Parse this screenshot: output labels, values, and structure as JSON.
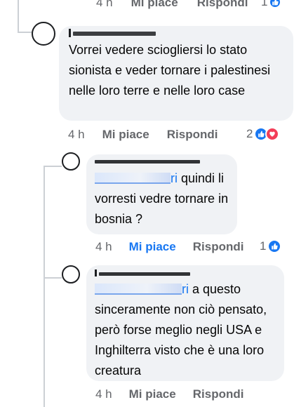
{
  "colors": {
    "link_blue": "#1877f2",
    "meta_grey": "#65676b",
    "bubble_bg": "#f0f2f5"
  },
  "top_row": {
    "time": "4 h",
    "like": "Mi piace",
    "reply": "Rispondi",
    "count": "1"
  },
  "comment1": {
    "text": "Vorrei vedere sciogliersi lo stato sionista e veder tornare i palestinesi nelle loro terre e nelle loro case",
    "time": "4 h",
    "like": "Mi piace",
    "reply": "Rispondi",
    "count": "2",
    "reactions": [
      "like-icon",
      "love-icon"
    ]
  },
  "reply1": {
    "mention_tail": "ri",
    "text": " quindi li vorresti vedre tornare in bosnia ?",
    "time": "4 h",
    "like": "Mi piace",
    "reply": "Rispondi",
    "count": "1",
    "liked": true,
    "reactions": [
      "like-icon"
    ]
  },
  "reply2": {
    "mention_tail": "ri",
    "text": " a questo sinceramente non ciò pensato, però forse meglio negli USA e Inghilterra visto che è una loro creatura",
    "time": "4 h",
    "like": "Mi piace",
    "reply": "Rispondi"
  }
}
